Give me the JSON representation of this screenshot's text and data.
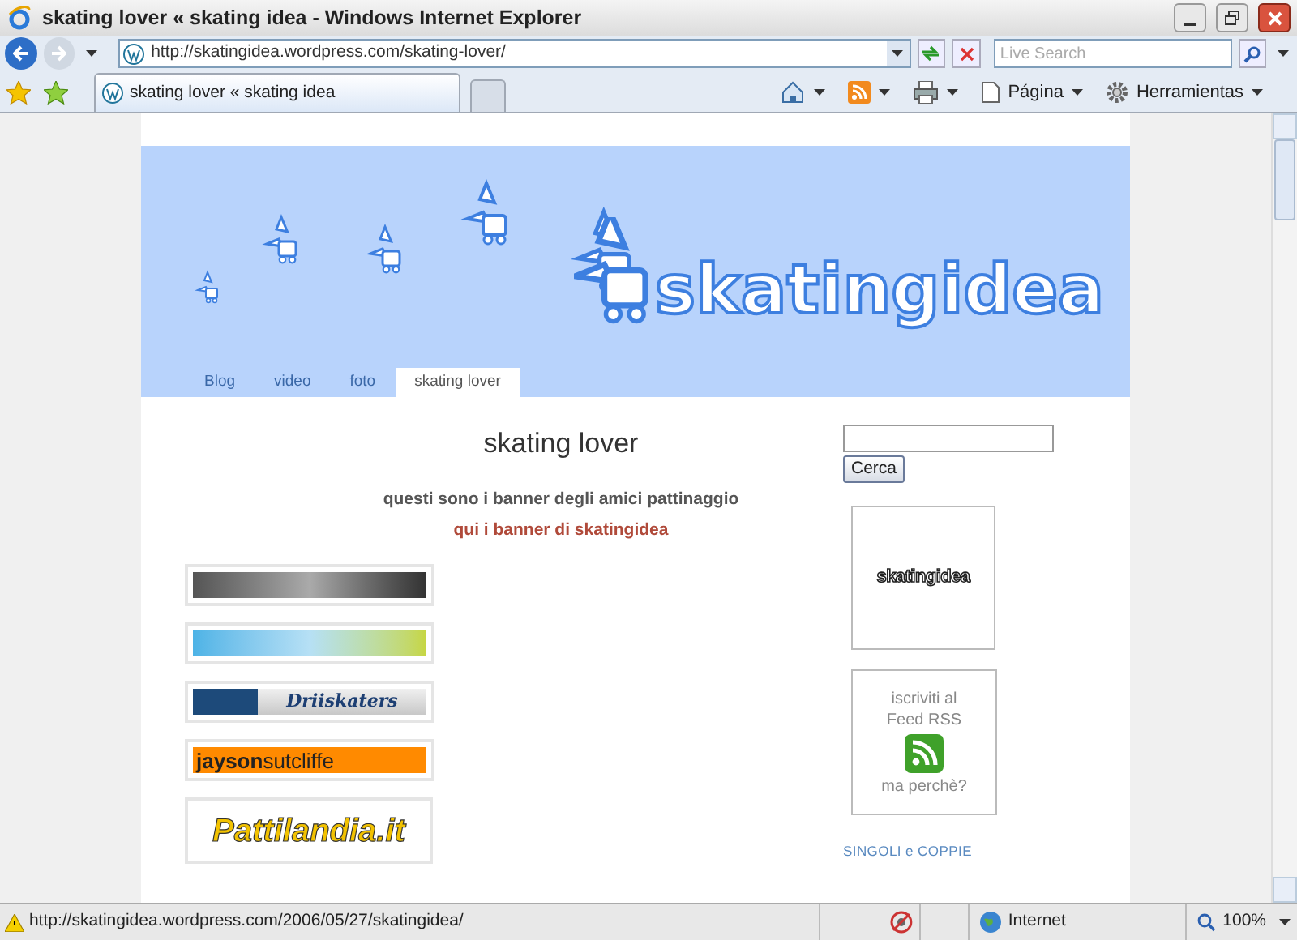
{
  "window": {
    "title": "skating lover « skating idea - Windows Internet Explorer"
  },
  "address_bar": {
    "url": "http://skatingidea.wordpress.com/skating-lover/"
  },
  "search": {
    "placeholder": "Live Search"
  },
  "tabs": [
    {
      "label": "skating lover « skating idea",
      "selected": true
    }
  ],
  "command_bar": [
    {
      "kind": "home"
    },
    {
      "kind": "feeds"
    },
    {
      "kind": "print"
    },
    {
      "kind": "page",
      "label": "Página"
    },
    {
      "kind": "tools",
      "label": "Herramientas"
    }
  ],
  "header": {
    "logo": "skatingidea",
    "nav": [
      {
        "label": "Blog",
        "selected": false
      },
      {
        "label": "video",
        "selected": false
      },
      {
        "label": "foto",
        "selected": false
      },
      {
        "label": "skating lover",
        "selected": true
      }
    ]
  },
  "post": {
    "title": "skating lover",
    "intro": "questi sono i banner degli amici pattinaggio",
    "link": "qui i banner di skatingidea",
    "banners": [
      {
        "kind": "dark"
      },
      {
        "kind": "colorful"
      },
      {
        "kind": "blue",
        "text": "Driiskaters"
      },
      {
        "kind": "orange",
        "text": "jayson",
        "text_2": "sutcliffe"
      },
      {
        "kind": "yellow",
        "text": "Pattilandia.it"
      }
    ]
  },
  "sidebar": {
    "search_button": "Cerca",
    "badge_logo": "skatingidea",
    "rss": {
      "line_1": "iscriviti al",
      "line_2": "Feed RSS",
      "line_3": "ma perchè?"
    },
    "links": [
      "SINGOLI e COPPIE"
    ]
  },
  "status_bar": {
    "url": "http://skatingidea.wordpress.com/2006/05/27/skatingidea/",
    "zone": "Internet",
    "zoom": "100%"
  }
}
